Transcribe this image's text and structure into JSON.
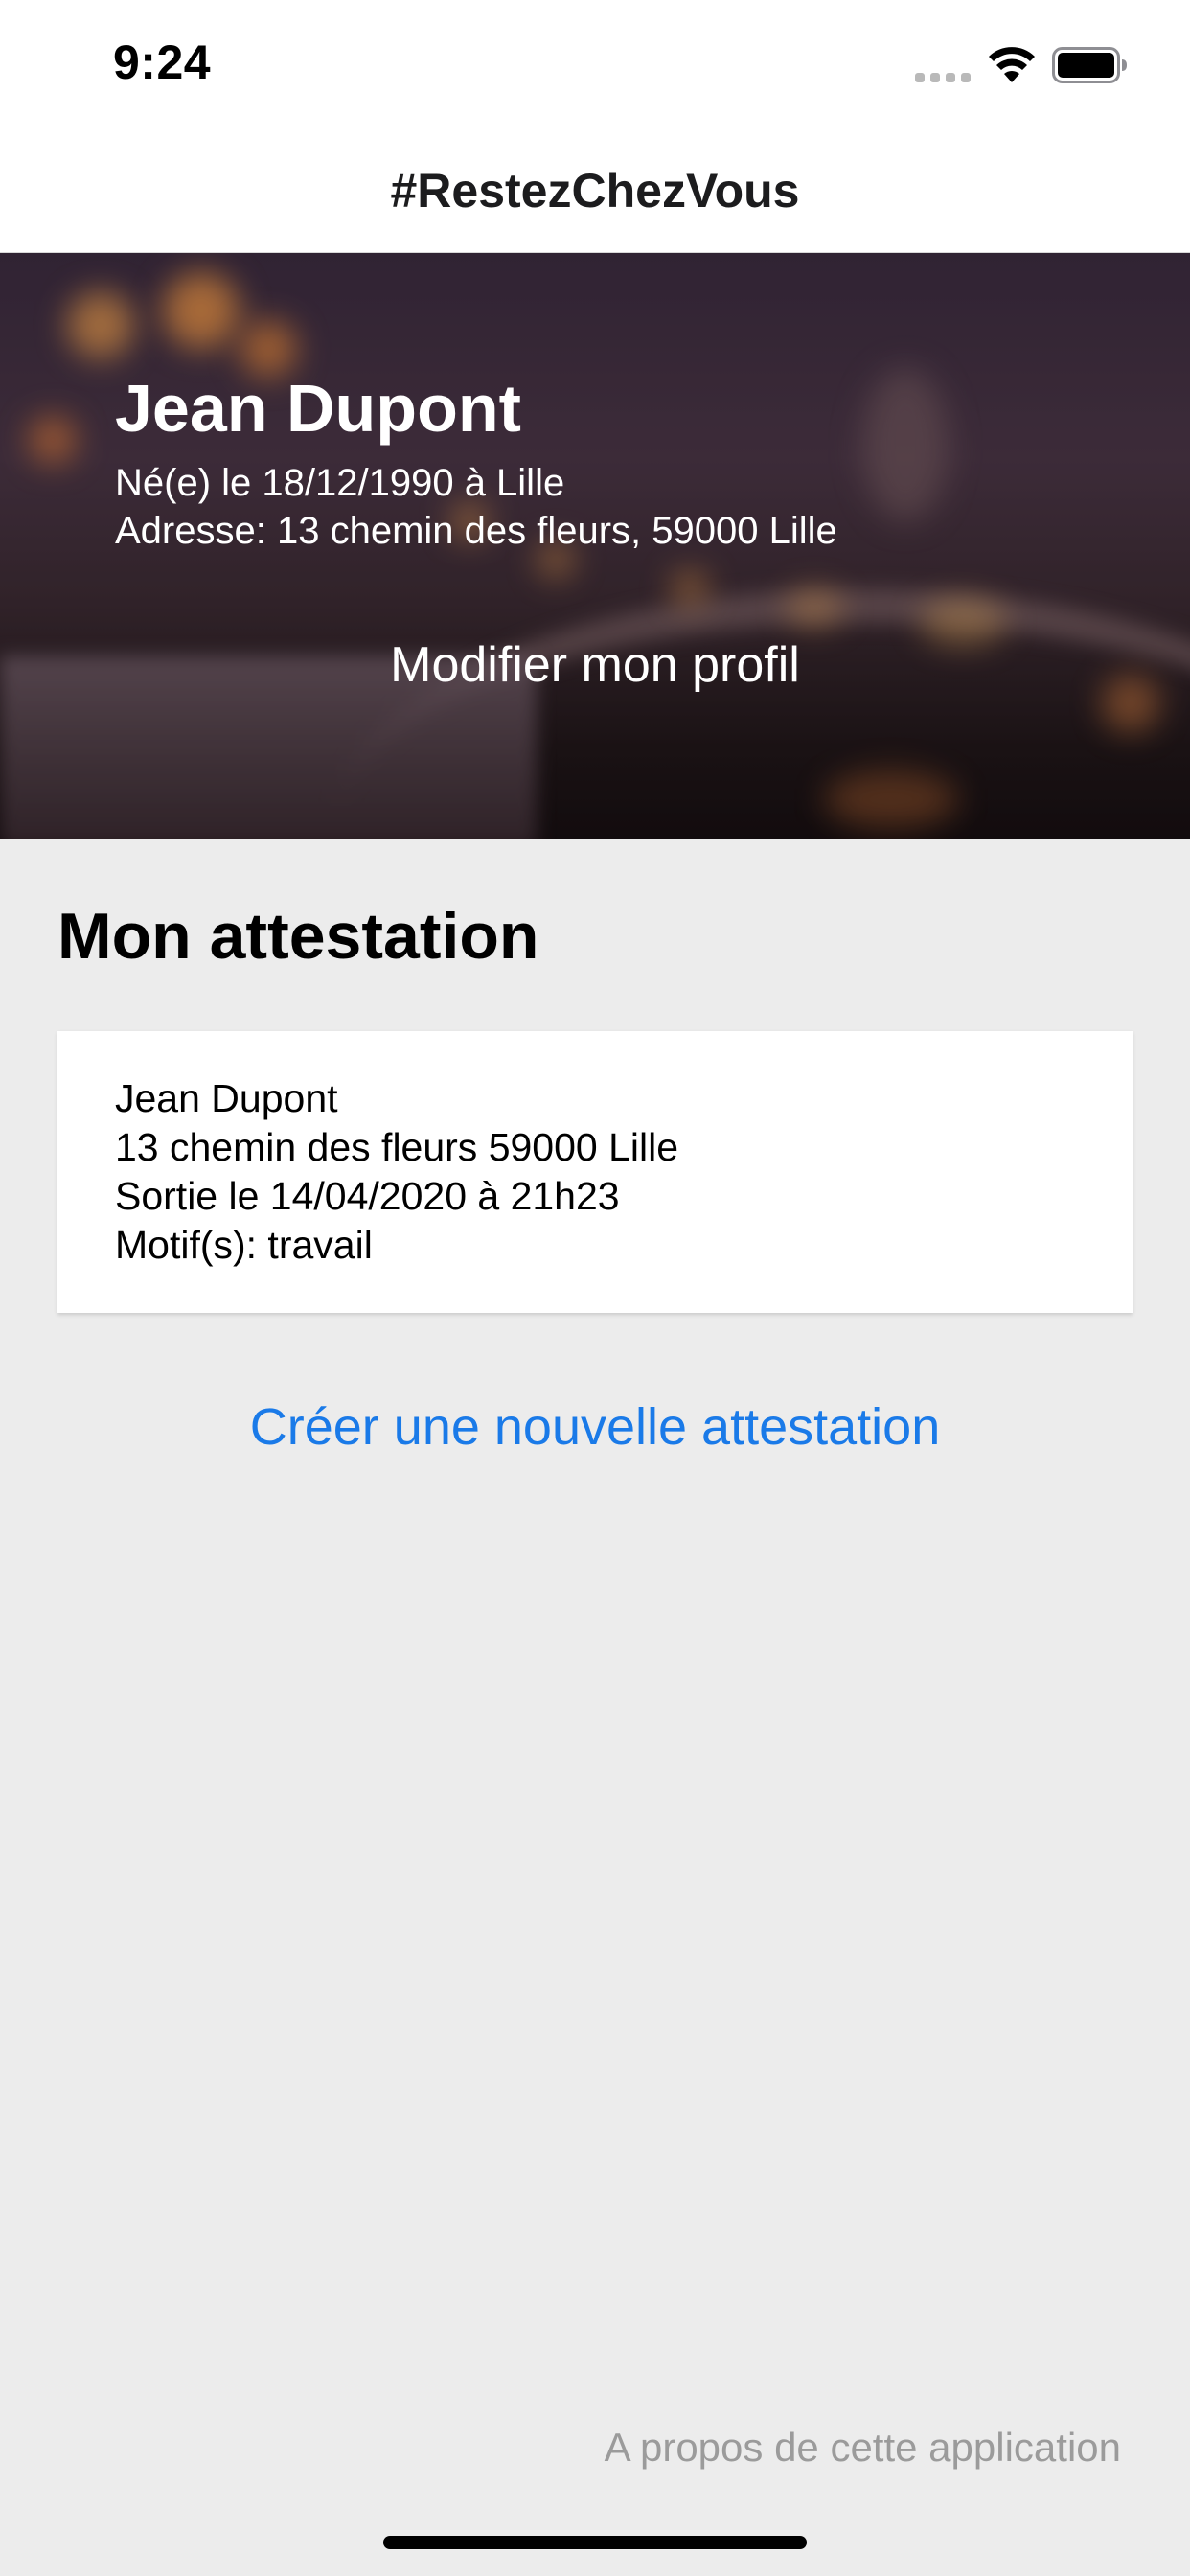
{
  "status_bar": {
    "time": "9:24",
    "icons": [
      "cellular-signal-icon",
      "wifi-icon",
      "battery-icon"
    ]
  },
  "nav": {
    "title": "#RestezChezVous"
  },
  "profile": {
    "name": "Jean Dupont",
    "birth": "Né(e) le 18/12/1990 à Lille",
    "address": "Adresse: 13 chemin des fleurs, 59000 Lille",
    "edit_label": "Modifier mon profil"
  },
  "attestation": {
    "section_title": "Mon attestation",
    "name": "Jean Dupont",
    "address": "13 chemin des fleurs 59000 Lille",
    "exit": "Sortie le 14/04/2020 à 21h23",
    "reason": "Motif(s): travail"
  },
  "actions": {
    "create_label": "Créer une nouvelle attestation",
    "about_label": "A propos de cette application"
  },
  "colors": {
    "link_blue": "#1a7ae8",
    "background": "#ececec",
    "muted_text": "#9b9b9b"
  }
}
